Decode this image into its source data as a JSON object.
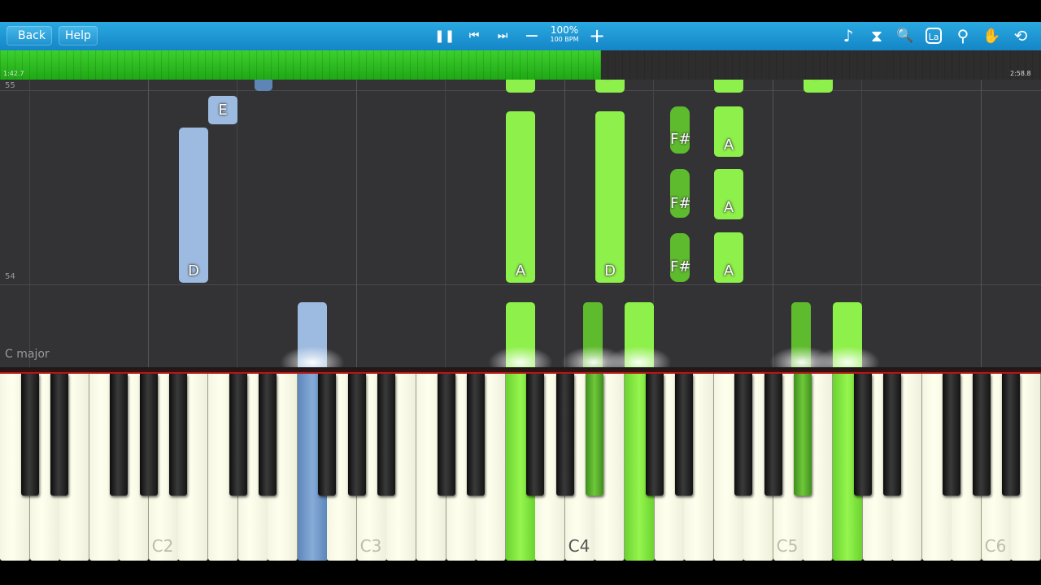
{
  "toolbar": {
    "back_label": "Back",
    "help_label": "Help",
    "tempo_percent": "100%",
    "tempo_bpm": "100 BPM",
    "icons": [
      "pause-icon",
      "previous-icon",
      "next-icon",
      "minus-icon",
      "plus-icon",
      "note-icon",
      "metronome-icon",
      "magnifier-icon",
      "la-icon",
      "location-pin-icon",
      "hand-icon",
      "loop-icon"
    ],
    "icon_glyphs": {
      "pause": "❚❚",
      "prev": "⏮",
      "next": "⏭",
      "minus": "−",
      "plus": "+",
      "note": "♪",
      "metronome": "⧗",
      "magnifier": "🔍",
      "la": "La",
      "pin": "⚲",
      "hand": "✋",
      "loop": "⟲"
    }
  },
  "progress": {
    "elapsed": "1:42.7",
    "total": "2:58.8",
    "fraction": 0.577,
    "color": "#2fc322"
  },
  "roll": {
    "measure_top": "55",
    "measure_mid": "54",
    "key_signature": "C major"
  },
  "notes": [
    {
      "label": "F#",
      "hand": "left-dark"
    },
    {
      "label": "E",
      "hand": "left"
    },
    {
      "label": "D",
      "hand": "left"
    },
    {
      "label": "",
      "hand": "left"
    },
    {
      "label": "A",
      "hand": "right"
    },
    {
      "label": "A",
      "hand": "right"
    },
    {
      "label": "",
      "hand": "right"
    },
    {
      "label": "D",
      "hand": "right"
    },
    {
      "label": "D",
      "hand": "right"
    },
    {
      "label": "",
      "hand": "right-dark"
    },
    {
      "label": "",
      "hand": "right"
    },
    {
      "label": "F#",
      "hand": "right-dark"
    },
    {
      "label": "F#",
      "hand": "right-dark"
    },
    {
      "label": "F#",
      "hand": "right-dark"
    },
    {
      "label": "A",
      "hand": "right"
    },
    {
      "label": "A",
      "hand": "right"
    },
    {
      "label": "A",
      "hand": "right"
    },
    {
      "label": "A",
      "hand": "right"
    },
    {
      "label": "D",
      "hand": "right"
    },
    {
      "label": "",
      "hand": "right-dark"
    },
    {
      "label": "",
      "hand": "right"
    }
  ],
  "keyboard": {
    "octave_labels": [
      "C2",
      "C3",
      "C4",
      "C5",
      "C6"
    ],
    "colors": {
      "left_hand": "#7aa3d6",
      "right_hand": "#8ef04a",
      "right_hand_dark": "#5fbb2e"
    }
  }
}
